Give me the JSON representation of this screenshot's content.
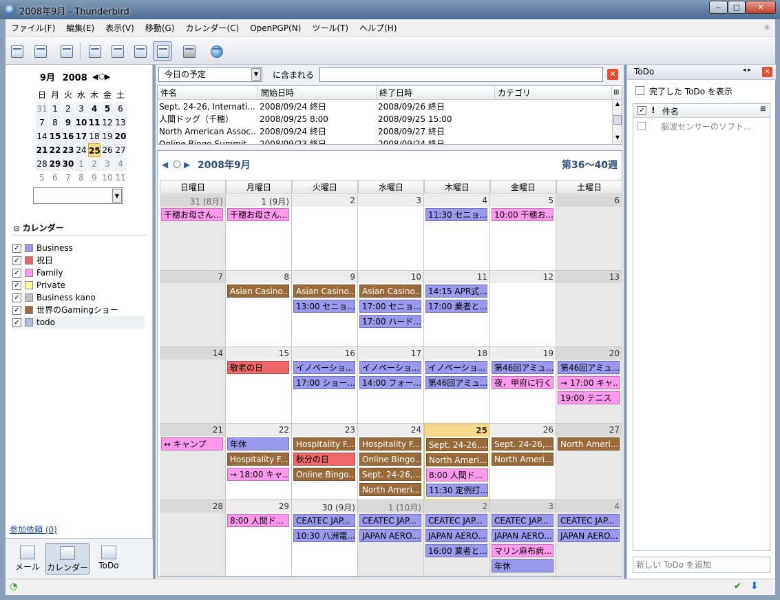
{
  "window": {
    "title": "2008年9月 - Thunderbird",
    "min": "‒",
    "max": "□",
    "close": "✕"
  },
  "menu": [
    "ファイル(F)",
    "編集(E)",
    "表示(V)",
    "移動(G)",
    "カレンダー(C)",
    "OpenPGP(N)",
    "ツール(T)",
    "ヘルプ(H)"
  ],
  "toolbar": [
    "new-event-icon",
    "new-task-icon",
    "download-icon",
    "day-view-icon",
    "week-view-icon",
    "multiweek-view-icon",
    "month-view-icon",
    "print-icon",
    "publish-globe-icon"
  ],
  "minimonth": {
    "month": "9月",
    "year": "2008",
    "weekdays": [
      "日",
      "月",
      "火",
      "水",
      "木",
      "金",
      "土"
    ],
    "weeks": [
      [
        "31",
        "1",
        "2",
        "3",
        "4",
        "5",
        "6"
      ],
      [
        "7",
        "8",
        "9",
        "10",
        "11",
        "12",
        "13"
      ],
      [
        "14",
        "15",
        "16",
        "17",
        "18",
        "19",
        "20"
      ],
      [
        "21",
        "22",
        "23",
        "24",
        "25",
        "26",
        "27"
      ],
      [
        "28",
        "29",
        "30",
        "1",
        "2",
        "3",
        "4"
      ],
      [
        "5",
        "6",
        "7",
        "8",
        "9",
        "10",
        "11"
      ]
    ],
    "bold": [
      "4",
      "5",
      "9",
      "10",
      "11",
      "15",
      "16",
      "17",
      "20",
      "21",
      "22",
      "23",
      "29",
      "30"
    ],
    "today": "25"
  },
  "calendars": {
    "header": "カレンダー",
    "items": [
      {
        "name": "Business",
        "color": "#9999ee"
      },
      {
        "name": "祝日",
        "color": "#ee6666"
      },
      {
        "name": "Family",
        "color": "#ff99ee"
      },
      {
        "name": "Private",
        "color": "#ffff99"
      },
      {
        "name": "Business kano",
        "color": "#c0c0c0"
      },
      {
        "name": "世界のGamingショー",
        "color": "#9a6a3a"
      },
      {
        "name": "todo",
        "color": "#a8c0dd"
      }
    ]
  },
  "invitations": "参加依頼 (0)",
  "modes": {
    "mail": "メール",
    "calendar": "カレンダー",
    "todo": "ToDo"
  },
  "filter": {
    "select": "今日の予定",
    "contains": "に含まれる",
    "search": ""
  },
  "list": {
    "columns": [
      "件名",
      "開始日時",
      "終了日時",
      "カテゴリ"
    ],
    "rows": [
      [
        "Sept. 24-26, Internati...",
        "2008/09/24 終日",
        "2008/09/26 終日",
        ""
      ],
      [
        "人間ドッグ（千穂）",
        "2008/09/25 8:00",
        "2008/09/25 15:00",
        ""
      ],
      [
        "North American Assoc...",
        "2008/09/24 終日",
        "2008/09/27 終日",
        ""
      ],
      [
        "Online Bingo Summit",
        "2008/09/23 終日",
        "2008/09/24 終日",
        ""
      ]
    ]
  },
  "month": {
    "title": "2008年9月",
    "weeks_label": "第36〜40週",
    "daynames": [
      "日曜日",
      "月曜日",
      "火曜日",
      "水曜日",
      "木曜日",
      "金曜日",
      "土曜日"
    ],
    "days": [
      {
        "n": "31 (8月)",
        "other": true,
        "events": [
          {
            "t": "千穂お母さん...",
            "c": "#ff99ee"
          }
        ]
      },
      {
        "n": "1 (9月)",
        "events": [
          {
            "t": "千穂お母さん...",
            "c": "#ff99ee"
          }
        ]
      },
      {
        "n": "2",
        "events": []
      },
      {
        "n": "3",
        "events": []
      },
      {
        "n": "4",
        "events": [
          {
            "t": "11:30 セニョ...",
            "c": "#9999ee"
          }
        ]
      },
      {
        "n": "5",
        "events": [
          {
            "t": "10:00 千穂お...",
            "c": "#ff99ee"
          }
        ]
      },
      {
        "n": "6",
        "events": []
      },
      {
        "n": "7",
        "events": []
      },
      {
        "n": "8",
        "events": [
          {
            "t": "Asian Casino...",
            "c": "#9a6a3a",
            "w": true
          }
        ]
      },
      {
        "n": "9",
        "events": [
          {
            "t": "Asian Casino...",
            "c": "#9a6a3a",
            "w": true
          },
          {
            "t": "13:00 セニョ...",
            "c": "#9999ee"
          }
        ]
      },
      {
        "n": "10",
        "events": [
          {
            "t": "Asian Casino...",
            "c": "#9a6a3a",
            "w": true
          },
          {
            "t": "17:00 セニョ...",
            "c": "#9999ee"
          },
          {
            "t": "17:00 ハード...",
            "c": "#9999ee"
          }
        ]
      },
      {
        "n": "11",
        "events": [
          {
            "t": "14:15 APR式...",
            "c": "#9999ee"
          },
          {
            "t": "17:00 業者と...",
            "c": "#9999ee"
          }
        ]
      },
      {
        "n": "12",
        "events": []
      },
      {
        "n": "13",
        "events": []
      },
      {
        "n": "14",
        "events": []
      },
      {
        "n": "15",
        "events": [
          {
            "t": "敬老の日",
            "c": "#ee6666"
          }
        ]
      },
      {
        "n": "16",
        "events": [
          {
            "t": "イノベーショ...",
            "c": "#9999ee"
          },
          {
            "t": "17:00 ショー...",
            "c": "#9999ee"
          }
        ]
      },
      {
        "n": "17",
        "events": [
          {
            "t": "イノベーショ...",
            "c": "#9999ee"
          },
          {
            "t": "14:00 フォー...",
            "c": "#9999ee"
          }
        ]
      },
      {
        "n": "18",
        "events": [
          {
            "t": "イノベーショ...",
            "c": "#9999ee"
          },
          {
            "t": "第46回アミュ...",
            "c": "#9999ee"
          }
        ]
      },
      {
        "n": "19",
        "events": [
          {
            "t": "第46回アミュ...",
            "c": "#9999ee"
          },
          {
            "t": "夜，甲府に行く",
            "c": "#ff99ee"
          }
        ]
      },
      {
        "n": "20",
        "events": [
          {
            "t": "第46回アミュ...",
            "c": "#9999ee"
          },
          {
            "t": "→ 17:00 キャ...",
            "c": "#ff99ee"
          },
          {
            "t": "19:00 テニス",
            "c": "#ff99ee"
          }
        ]
      },
      {
        "n": "21",
        "events": [
          {
            "t": "↔ キャンプ",
            "c": "#ff99ee"
          }
        ]
      },
      {
        "n": "22",
        "events": [
          {
            "t": "年休",
            "c": "#9999ee"
          },
          {
            "t": "Hospitality F...",
            "c": "#9a6a3a",
            "w": true
          },
          {
            "t": "→ 18:00 キャ...",
            "c": "#ff99ee"
          }
        ]
      },
      {
        "n": "23",
        "events": [
          {
            "t": "Hospitality F...",
            "c": "#9a6a3a",
            "w": true
          },
          {
            "t": "秋分の日",
            "c": "#ee6666"
          },
          {
            "t": "Online Bingo...",
            "c": "#9a6a3a",
            "w": true
          }
        ]
      },
      {
        "n": "24",
        "events": [
          {
            "t": "Hospitality F...",
            "c": "#9a6a3a",
            "w": true
          },
          {
            "t": "Online Bingo...",
            "c": "#9a6a3a",
            "w": true
          },
          {
            "t": "Sept. 24-26,...",
            "c": "#9a6a3a",
            "w": true
          },
          {
            "t": "North Ameri...",
            "c": "#9a6a3a",
            "w": true
          }
        ]
      },
      {
        "n": "25",
        "today": true,
        "events": [
          {
            "t": "Sept. 24-26,...",
            "c": "#9a6a3a",
            "w": true
          },
          {
            "t": "North Ameri...",
            "c": "#9a6a3a",
            "w": true
          },
          {
            "t": "8:00 人間ド...",
            "c": "#ff99ee"
          },
          {
            "t": "11:30 定例打...",
            "c": "#9999ee"
          }
        ]
      },
      {
        "n": "26",
        "events": [
          {
            "t": "Sept. 24-26,...",
            "c": "#9a6a3a",
            "w": true
          },
          {
            "t": "North Ameri...",
            "c": "#9a6a3a",
            "w": true
          }
        ]
      },
      {
        "n": "27",
        "events": [
          {
            "t": "North Ameri...",
            "c": "#9a6a3a",
            "w": true
          }
        ]
      },
      {
        "n": "28",
        "events": []
      },
      {
        "n": "29",
        "events": [
          {
            "t": "8:00 人間ド...",
            "c": "#ff99ee"
          }
        ]
      },
      {
        "n": "30 (9月)",
        "events": [
          {
            "t": "CEATEC JAP...",
            "c": "#9999ee"
          },
          {
            "t": "10:30 八洲電...",
            "c": "#9999ee"
          }
        ]
      },
      {
        "n": "1 (10月)",
        "other": true,
        "events": [
          {
            "t": "CEATEC JAP...",
            "c": "#9999ee"
          },
          {
            "t": "JAPAN AERO...",
            "c": "#9999ee"
          }
        ]
      },
      {
        "n": "2",
        "other": true,
        "events": [
          {
            "t": "CEATEC JAP...",
            "c": "#9999ee"
          },
          {
            "t": "JAPAN AERO...",
            "c": "#9999ee"
          },
          {
            "t": "16:00 業者と...",
            "c": "#9999ee"
          }
        ]
      },
      {
        "n": "3",
        "other": true,
        "events": [
          {
            "t": "CEATEC JAP...",
            "c": "#9999ee"
          },
          {
            "t": "JAPAN AERO...",
            "c": "#9999ee"
          },
          {
            "t": "マリン麻布病...",
            "c": "#ff99ee"
          },
          {
            "t": "年休",
            "c": "#9999ee"
          }
        ]
      },
      {
        "n": "4",
        "other": true,
        "events": [
          {
            "t": "CEATEC JAP...",
            "c": "#9999ee"
          },
          {
            "t": "JAPAN AERO...",
            "c": "#9999ee"
          }
        ]
      }
    ]
  },
  "todo": {
    "title": "ToDo",
    "show_completed": "完了した ToDo を表示",
    "column": "件名",
    "items": [
      "脳波センサーのソフト..."
    ],
    "add_placeholder": "新しい ToDo を追加"
  }
}
